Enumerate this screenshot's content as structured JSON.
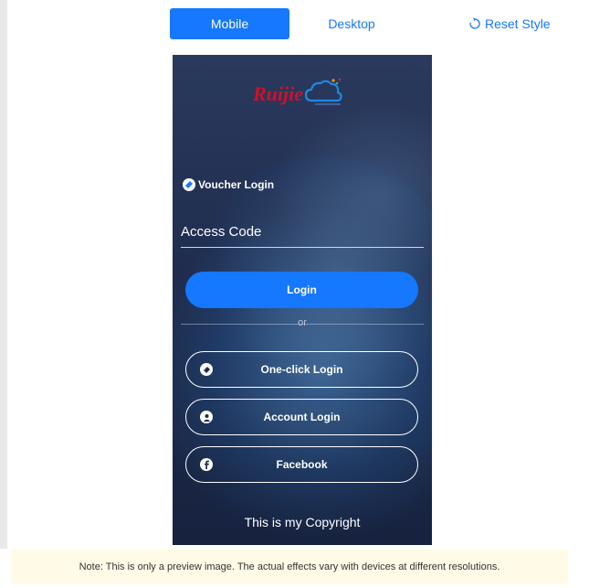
{
  "toolbar": {
    "mode_mobile": "Mobile",
    "mode_desktop": "Desktop",
    "reset_label": "Reset Style",
    "reset_icon": "refresh-icon"
  },
  "preview": {
    "brand_logo": "Ruijie",
    "voucher_label": "Voucher Login",
    "voucher_icon": "voucher-icon",
    "access_code_placeholder": "Access Code",
    "access_code_value": "",
    "login_label": "Login",
    "or_label": "or",
    "alt_logins": [
      {
        "label": "One-click Login",
        "icon": "one-click-icon"
      },
      {
        "label": "Account Login",
        "icon": "user-icon"
      },
      {
        "label": "Facebook",
        "icon": "facebook-icon"
      }
    ],
    "copyright": "This is my Copyright"
  },
  "note": "Note: This is only a preview image. The actual effects vary with devices at different resolutions.",
  "colors": {
    "accent": "#1677ff",
    "note_bg": "#fffbe6",
    "preview_bg": "#1f2c4d"
  }
}
